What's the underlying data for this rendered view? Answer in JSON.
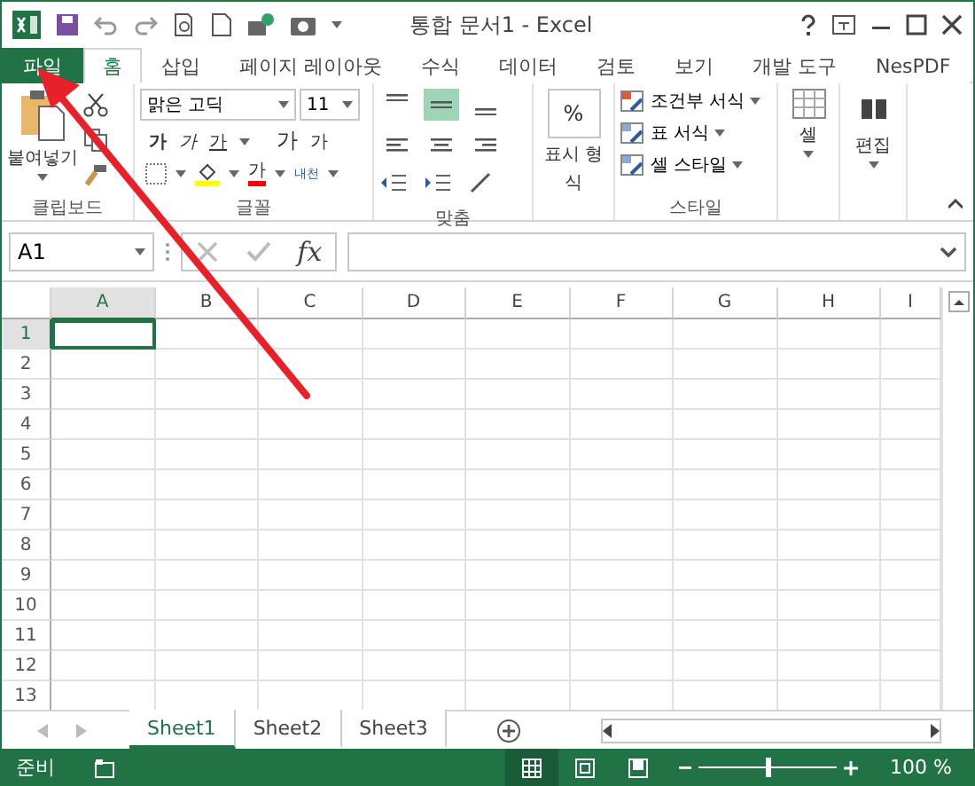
{
  "window": {
    "title": "통합 문서1 - Excel"
  },
  "tabs": [
    {
      "label": "파일",
      "kind": "file",
      "selected": false
    },
    {
      "label": "홈",
      "kind": "tab",
      "selected": true
    },
    {
      "label": "삽입",
      "kind": "tab",
      "selected": false
    },
    {
      "label": "페이지 레이아웃",
      "kind": "tab",
      "selected": false
    },
    {
      "label": "수식",
      "kind": "tab",
      "selected": false
    },
    {
      "label": "데이터",
      "kind": "tab",
      "selected": false
    },
    {
      "label": "검토",
      "kind": "tab",
      "selected": false
    },
    {
      "label": "보기",
      "kind": "tab",
      "selected": false
    },
    {
      "label": "개발 도구",
      "kind": "tab",
      "selected": false
    },
    {
      "label": "NesPDF",
      "kind": "tab",
      "selected": false
    }
  ],
  "ribbon": {
    "clipboard": {
      "paste": "붙여넣기",
      "label": "클립보드"
    },
    "font": {
      "name": "맑은 고딕",
      "size": "11",
      "bold": "가",
      "italic": "가",
      "underline": "가",
      "font_color": "가",
      "grow": "가",
      "shrink": "가",
      "phonetic": "내천",
      "label": "글꼴"
    },
    "alignment": {
      "buttons": [
        {
          "kind": "top",
          "selected": false
        },
        {
          "kind": "middle",
          "selected": true
        },
        {
          "kind": "bottom",
          "selected": false
        },
        {
          "kind": "left",
          "selected": false
        },
        {
          "kind": "center",
          "selected": false
        },
        {
          "kind": "right",
          "selected": false
        }
      ],
      "label": "맞춤"
    },
    "number": {
      "symbol": "%",
      "label_1": "표시 형",
      "label_2": "식"
    },
    "styles": {
      "items": [
        "조건부 서식",
        "표 서식",
        "셀 스타일"
      ],
      "label": "스타일"
    },
    "cells": {
      "label": "셀"
    },
    "editing": {
      "label": "편집"
    }
  },
  "formula_bar": {
    "name_box": "A1",
    "fx": "fx"
  },
  "columns": [
    {
      "label": "A",
      "selected": true
    },
    {
      "label": "B",
      "selected": false
    },
    {
      "label": "C",
      "selected": false
    },
    {
      "label": "D",
      "selected": false
    },
    {
      "label": "E",
      "selected": false
    },
    {
      "label": "F",
      "selected": false
    },
    {
      "label": "G",
      "selected": false
    },
    {
      "label": "H",
      "selected": false
    },
    {
      "label": "I",
      "selected": false
    }
  ],
  "rows": [
    {
      "label": "1",
      "selected": true
    },
    {
      "label": "2",
      "selected": false
    },
    {
      "label": "3",
      "selected": false
    },
    {
      "label": "4",
      "selected": false
    },
    {
      "label": "5",
      "selected": false
    },
    {
      "label": "6",
      "selected": false
    },
    {
      "label": "7",
      "selected": false
    },
    {
      "label": "8",
      "selected": false
    },
    {
      "label": "9",
      "selected": false
    },
    {
      "label": "10",
      "selected": false
    },
    {
      "label": "11",
      "selected": false
    },
    {
      "label": "12",
      "selected": false
    },
    {
      "label": "13",
      "selected": false
    }
  ],
  "sheets": [
    {
      "label": "Sheet1",
      "selected": true
    },
    {
      "label": "Sheet2",
      "selected": false
    },
    {
      "label": "Sheet3",
      "selected": false
    }
  ],
  "status_bar": {
    "state": "준비",
    "views": [
      {
        "kind": "normal",
        "selected": true
      },
      {
        "kind": "layout",
        "selected": false
      },
      {
        "kind": "break",
        "selected": false
      }
    ],
    "zoom": {
      "level": 0.5,
      "reading": "100 %"
    }
  }
}
